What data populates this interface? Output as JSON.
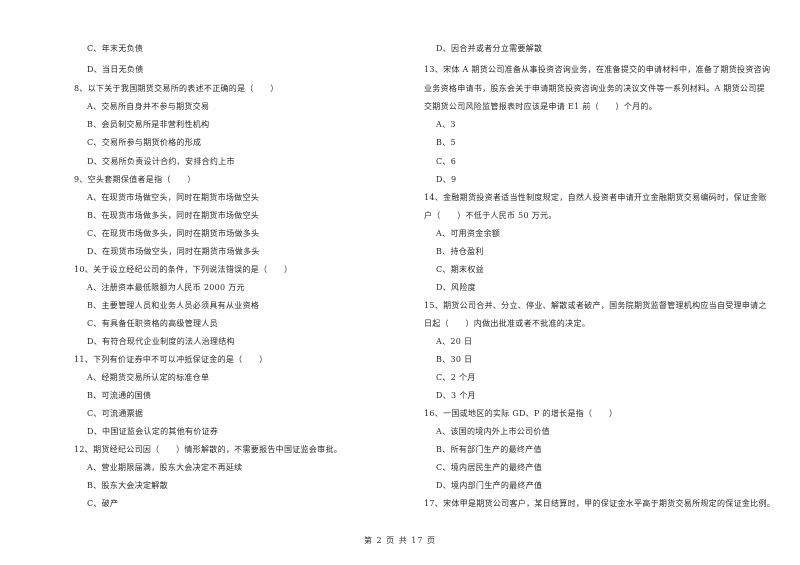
{
  "page": {
    "footer": "第 2 页 共 17 页"
  },
  "left": {
    "q7_tail": [
      "C、年末无负债",
      "D、当日无负债"
    ],
    "q8": {
      "stem": "8、以下关于我国期货交易所的表述不正确的是（　　）",
      "options": [
        "A、交易所自身并不参与期货交易",
        "B、会员制交易所是非营利性机构",
        "C、交易所参与期货价格的形成",
        "D、交易所负责设计合约、安排合约上市"
      ]
    },
    "q9": {
      "stem": "9、空头套期保值者是指（　　）",
      "options": [
        "A、在现货市场做空头，同时在期货市场做空头",
        "B、在现货市场做多头，同时在期货市场做空头",
        "C、在现货市场做多头，同时在期货市场做多头",
        "D、在现货市场做空头，同时在期货市场做多头"
      ]
    },
    "q10": {
      "stem": "10、关于设立经纪公司的条件，下列说法错误的是（　　）",
      "options": [
        "A、注册资本最低限额为人民币 2000 万元",
        "B、主要管理人员和业务人员必须具有从业资格",
        "C、有具备任职资格的高级管理人员",
        "D、有符合现代企业制度的法人治理结构"
      ]
    },
    "q11": {
      "stem": "11、下列有价证券中不可以冲抵保证金的是（　　）",
      "options": [
        "A、经期货交易所认定的标准仓单",
        "B、可流通的国债",
        "C、可流通票据",
        "D、中国证监会认定的其他有价证券"
      ]
    },
    "q12": {
      "stem": "12、期货经纪公司因（　　）情形解散的，不需要报告中国证监会审批。",
      "options": [
        "A、营业期限届满，股东大会决定不再延续",
        "B、股东大会决定解散",
        "C、破产"
      ]
    }
  },
  "right": {
    "q12_tail": [
      "D、因合并或者分立需要解散"
    ],
    "q13": {
      "stem_lines": [
        "13、宋体 A 期货公司准备从事投资咨询业务，在准备提交的申请材料中，准备了期货投资咨询",
        "业务资格申请书，股东会关于申请期货投资咨询业务的决议文件等一系列材料。A 期货公司提",
        "交期货公司风险监管报表时应该是申请 E1 前（　　）个月的。"
      ],
      "options": [
        "A、3",
        "B、5",
        "C、6",
        "D、9"
      ]
    },
    "q14": {
      "stem_lines": [
        "14、金融期货投资者适当性制度规定，自然人投资者申请开立金融期货交易编码时，保证金账",
        "户（　　）不低于人民币 50 万元。"
      ],
      "options": [
        "A、可用资金余额",
        "B、持仓盈利",
        "C、期末权益",
        "D、风险度"
      ]
    },
    "q15": {
      "stem_lines": [
        "15、期货公司合并、分立、停业、解散或者破产，国务院期货监督管理机构应当自受理申请之",
        "日起（　　）内做出批准或者不批准的决定。"
      ],
      "options": [
        "A、20 日",
        "B、30 日",
        "C、2 个月",
        "D、3 个月"
      ]
    },
    "q16": {
      "stem": "16、一国或地区的实际 GD、P 的增长是指（　　）",
      "options": [
        "A、该国的境内外上市公司价值",
        "B、所有部门生产的最终产值",
        "C、境内居民生产的最终产值",
        "D、境内部门生产的最终产值"
      ]
    },
    "q17": {
      "stem": "17、宋体甲是期货公司客户，某日结算时，甲的保证金水平高于期货交易所规定的保证金比例。"
    }
  }
}
